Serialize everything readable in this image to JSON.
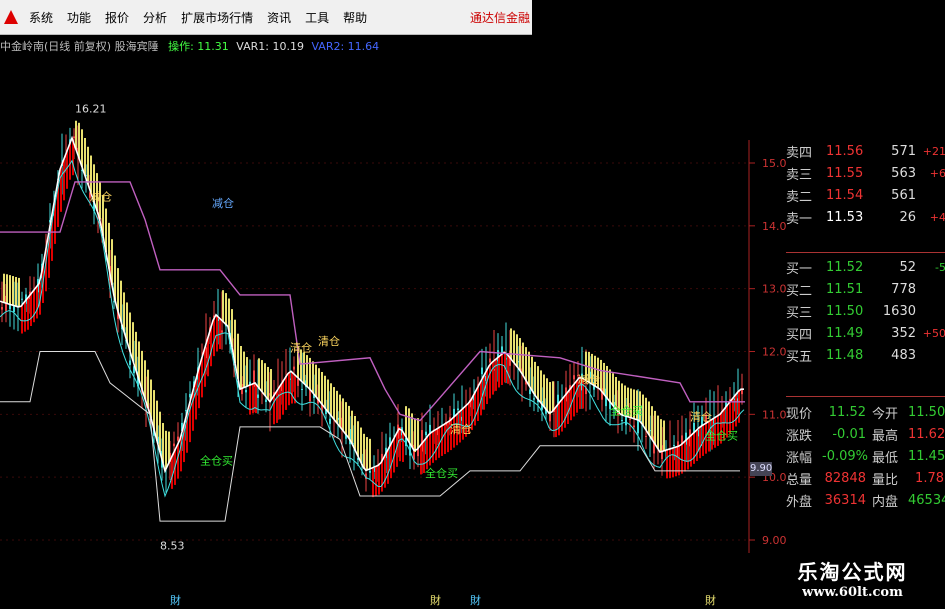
{
  "menu": {
    "items": [
      "系统",
      "功能",
      "报价",
      "分析",
      "扩展市场行情",
      "资讯",
      "工具",
      "帮助"
    ],
    "brand": "通达信金融"
  },
  "title": {
    "text": "中金岭南(日线 前复权) 股海宾陲",
    "op": "操作: 11.31",
    "var1": "VAR1: 10.19",
    "var2": "VAR2: 11.64"
  },
  "chart": {
    "y_ticks": [
      "15.00",
      "14.00",
      "13.00",
      "12.00",
      "11.00",
      "10.00",
      "9.00"
    ],
    "high_label": "16.21",
    "low_label": "8.53",
    "signals": [
      "减仓",
      "减仓",
      "清仓",
      "清仓",
      "全仓买",
      "全仓买",
      "全仓买",
      "清仓",
      "减仓",
      "清仓",
      "全仓买"
    ],
    "bottom_markers": [
      "財",
      "財",
      "財",
      "財"
    ],
    "price_tag": "9.90",
    "colors": {
      "bull": "#e00000",
      "bear": "#e8e070",
      "line": "#ffffff",
      "stop": "#c060c0",
      "cyan": "#40e0e0"
    }
  },
  "quote": {
    "asks": [
      {
        "name": "卖四",
        "price": "11.56",
        "vol": "571",
        "chg": "+21"
      },
      {
        "name": "卖三",
        "price": "11.55",
        "vol": "563",
        "chg": "+6"
      },
      {
        "name": "卖二",
        "price": "11.54",
        "vol": "561",
        "chg": ""
      },
      {
        "name": "卖一",
        "price": "11.53",
        "vol": "26",
        "chg": "+4"
      }
    ],
    "bids": [
      {
        "name": "买一",
        "price": "11.52",
        "vol": "52",
        "chg": "-5"
      },
      {
        "name": "买二",
        "price": "11.51",
        "vol": "778",
        "chg": ""
      },
      {
        "name": "买三",
        "price": "11.50",
        "vol": "1630",
        "chg": ""
      },
      {
        "name": "买四",
        "price": "11.49",
        "vol": "352",
        "chg": "+50"
      },
      {
        "name": "买五",
        "price": "11.48",
        "vol": "483",
        "chg": ""
      }
    ],
    "stats": [
      {
        "k": "现价",
        "v": "11.52",
        "k2": "今开",
        "v2": "11.50"
      },
      {
        "k": "涨跌",
        "v": "-0.01",
        "k2": "最高",
        "v2": "11.62"
      },
      {
        "k": "涨幅",
        "v": "-0.09%",
        "k2": "最低",
        "v2": "11.45"
      },
      {
        "k": "总量",
        "v": "82848",
        "k2": "量比",
        "v2": "1.78"
      },
      {
        "k": "外盘",
        "v": "36314",
        "k2": "内盘",
        "v2": "46534"
      }
    ]
  },
  "watermark": {
    "cn": "乐淘公式网",
    "url": "www.60lt.com"
  }
}
